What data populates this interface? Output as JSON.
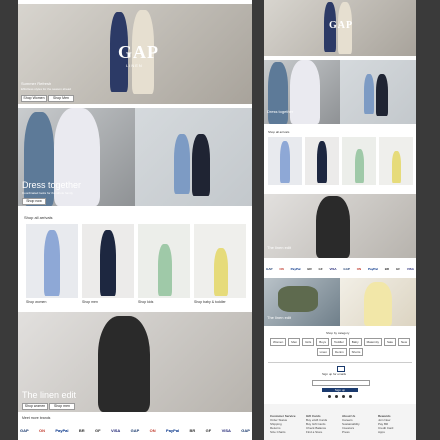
{
  "left": {
    "hero": {
      "brand": "GAP",
      "sub": "LINEN",
      "title": "Summer Refresh",
      "desc": "Effortless styles for the season ahead",
      "cta1": "Shop Women",
      "cta2": "Shop Men"
    },
    "together": {
      "title": "Dress together",
      "desc": "Coordinated looks for the whole family",
      "cta": "Shop now"
    },
    "shop_title": "Shop all arrivals",
    "products": [
      {
        "caption": "Shop women"
      },
      {
        "caption": "Shop men"
      },
      {
        "caption": "Shop kids"
      },
      {
        "caption": "Shop baby & toddler"
      }
    ],
    "linen": {
      "title": "The linen edit",
      "cta1": "Shop women",
      "cta2": "Shop men"
    },
    "brands_title": "Meet more brands",
    "brands": [
      "GAP",
      "ON",
      "PayPal",
      "BR",
      "GF",
      "VISA",
      "GAP",
      "ON",
      "PayPal",
      "BR",
      "GF",
      "VISA",
      "GAP"
    ]
  },
  "right": {
    "together_title": "Dress together",
    "shop_title": "Shop all arrivals",
    "linen_title": "The linen edit",
    "brands": [
      "GAP",
      "ON",
      "PayPal",
      "BR",
      "GF",
      "VISA",
      "GAP",
      "ON",
      "PayPal",
      "BR",
      "GF",
      "VISA"
    ],
    "promo_title": "The linen edit",
    "filters_title": "Shop by category",
    "chips": [
      "Women",
      "Men",
      "Girls",
      "Boys",
      "Toddler",
      "Baby",
      "Maternity",
      "Sale",
      "New",
      "Linen",
      "Denim",
      "Shorts"
    ],
    "newsletter_title": "Sign up for emails",
    "newsletter_btn": "Sign up",
    "footer_cols": [
      [
        "Customer Service",
        "Order Status",
        "Shipping",
        "Returns",
        "Size Charts",
        "Contact Us"
      ],
      [
        "Gift Cards",
        "Buy eGift Cards",
        "Buy Gift Cards",
        "Check Balance",
        "Find a Store"
      ],
      [
        "About Us",
        "Careers",
        "Sustainability",
        "Investors",
        "Press"
      ],
      [
        "Rewards",
        "Join Now",
        "Pay Bill",
        "Credit Card",
        "Apps"
      ]
    ]
  },
  "colors": {
    "background": "#3a3a3a",
    "panel": "#ffffff",
    "accent": "#1a3a6e"
  }
}
